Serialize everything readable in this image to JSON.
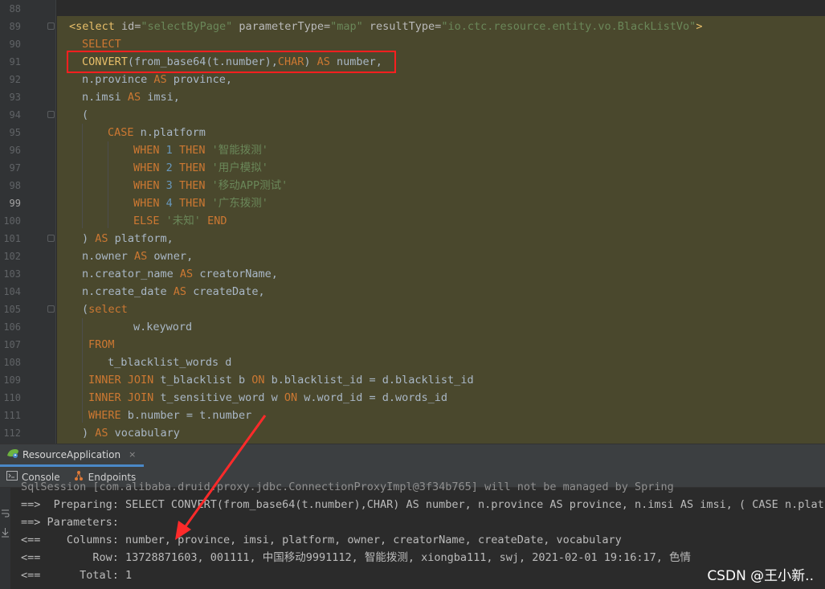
{
  "editor": {
    "line_numbers": [
      "88",
      "89",
      "90",
      "91",
      "92",
      "93",
      "94",
      "95",
      "96",
      "97",
      "98",
      "99",
      "100",
      "101",
      "102",
      "103",
      "104",
      "105",
      "106",
      "107",
      "108",
      "109",
      "110",
      "111",
      "112"
    ],
    "current_line": "99",
    "select_open": {
      "tag_open": "<select",
      "id_attr": " id=",
      "id_val": "\"selectByPage\"",
      "pt_attr": " parameterType=",
      "pt_val": "\"map\"",
      "rt_attr": " resultType=",
      "rt_val": "\"io.ctc.resource.entity.vo.BlackListVo\"",
      "tag_close": ">"
    },
    "l_select": "SELECT",
    "l_convert": {
      "fn": "CONVERT",
      "a": "(from_base64(t.number),",
      "char": "CHAR",
      "b": ") ",
      "as": "AS",
      "c": " number,"
    },
    "l_province": {
      "a": "n.province ",
      "as": "AS",
      "b": " province,"
    },
    "l_imsi": {
      "a": "n.imsi ",
      "as": "AS",
      "b": " imsi,"
    },
    "l_paren": "(",
    "l_case": {
      "kw": "CASE",
      "b": " n.platform"
    },
    "when_rows": [
      {
        "when": "WHEN",
        "num": "1",
        "then": "THEN",
        "str": "'智能拨测'"
      },
      {
        "when": "WHEN",
        "num": "2",
        "then": "THEN",
        "str": "'用户模拟'"
      },
      {
        "when": "WHEN",
        "num": "3",
        "then": "THEN",
        "str": "'移动APP测试'"
      },
      {
        "when": "WHEN",
        "num": "4",
        "then": "THEN",
        "str": "'广东拨测'"
      }
    ],
    "l_else": {
      "kw": "ELSE",
      "str": "'未知'",
      "end": "END"
    },
    "l_platform": {
      "a": ") ",
      "as": "AS",
      "b": " platform,"
    },
    "l_owner": {
      "a": "n.owner ",
      "as": "AS",
      "b": " owner,"
    },
    "l_creator": {
      "a": "n.creator_name ",
      "as": "AS",
      "b": " creatorName,"
    },
    "l_date": {
      "a": "n.create_date ",
      "as": "AS",
      "b": " createDate,"
    },
    "l_subselect": {
      "a": "(",
      "kw": "select"
    },
    "l_keyword": "w.keyword",
    "l_from": "FROM",
    "l_tbw": "t_blacklist_words d",
    "l_join1": {
      "inner": "INNER",
      "join": "JOIN",
      "a": " t_blacklist b ",
      "on": "ON",
      "b": " b.blacklist_id = d.blacklist_id"
    },
    "l_join2": {
      "inner": "INNER",
      "join": "JOIN",
      "a": " t_sensitive_word w ",
      "on": "ON",
      "b": " w.word_id = d.words_id"
    },
    "l_where": {
      "kw": "WHERE",
      "b": " b.number = t.number"
    },
    "l_vocab": {
      "a": ") ",
      "as": "AS",
      "b": " vocabulary"
    }
  },
  "run_tab": {
    "label": "ResourceApplication",
    "icon": "spring-boot-icon"
  },
  "toolbar": {
    "console_label": "Console",
    "endpoints_label": "Endpoints"
  },
  "console": {
    "l0": "SqlSession [com.alibaba.druid.proxy.jdbc.ConnectionProxyImpl@3f34b765] will not be managed by Spring",
    "l1": "==>  Preparing: SELECT CONVERT(from_base64(t.number),CHAR) AS number, n.province AS province, n.imsi AS imsi, ( CASE n.platform",
    "l2": "==> Parameters: ",
    "l3": "<==    Columns: number, province, imsi, platform, owner, creatorName, createDate, vocabulary",
    "l4": "<==        Row: 13728871603, 001111, 中国移动9991112, 智能拨测, xiongba111, swj, 2021-02-01 19:16:17, 色情",
    "l5": "<==      Total: 1"
  },
  "watermark": "CSDN @王小新..",
  "colors": {
    "highlight_box": "#ff1f1f",
    "arrow": "#ff2a2a",
    "code_bg": "#4a482d"
  }
}
